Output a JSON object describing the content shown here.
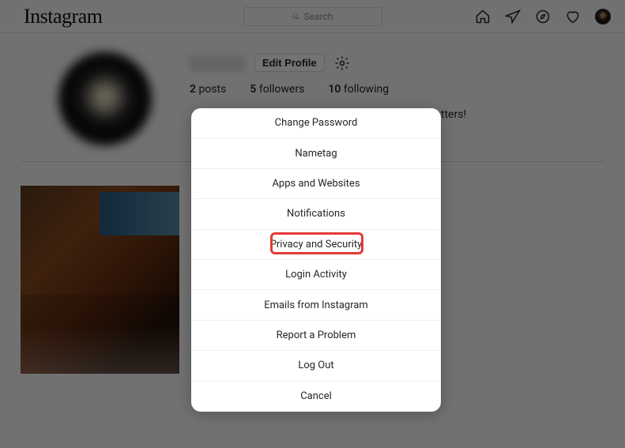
{
  "nav": {
    "logo": "Instagram",
    "search_placeholder": "Search"
  },
  "profile": {
    "edit_button": "Edit Profile",
    "posts_count": "2",
    "posts_label": "posts",
    "followers_count": "5",
    "followers_label": "followers",
    "following_count": "10",
    "following_label": "following",
    "bio_fragment": "ryone matters!"
  },
  "modal": {
    "items": [
      "Change Password",
      "Nametag",
      "Apps and Websites",
      "Notifications",
      "Privacy and Security",
      "Login Activity",
      "Emails from Instagram",
      "Report a Problem",
      "Log Out",
      "Cancel"
    ]
  }
}
